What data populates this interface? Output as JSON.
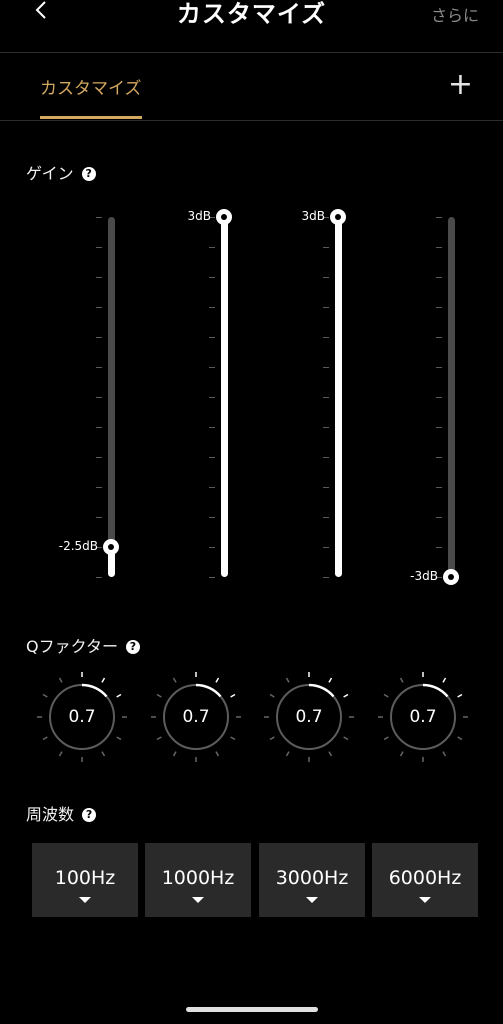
{
  "header": {
    "title": "カスタマイズ",
    "more_label": "さらに",
    "back_icon": "chevron-left-icon"
  },
  "tabs": {
    "active_label": "カスタマイズ",
    "add_icon": "plus-icon",
    "add_glyph": "+"
  },
  "colors": {
    "accent": "#d3a861",
    "track": "#4a4a4a",
    "fill": "#ffffff",
    "button_bg": "#2a2a2a"
  },
  "gain": {
    "label": "ゲイン",
    "help_glyph": "?",
    "range_db": [
      -3,
      3
    ],
    "bands": [
      {
        "value_label": "-2.5dB",
        "value_db": -2.5
      },
      {
        "value_label": "3dB",
        "value_db": 3
      },
      {
        "value_label": "3dB",
        "value_db": 3
      },
      {
        "value_label": "-3dB",
        "value_db": -3
      }
    ]
  },
  "q_factor": {
    "label": "Qファクター",
    "help_glyph": "?",
    "knobs": [
      {
        "value": "0.7"
      },
      {
        "value": "0.7"
      },
      {
        "value": "0.7"
      },
      {
        "value": "0.7"
      }
    ]
  },
  "frequency": {
    "label": "周波数",
    "help_glyph": "?",
    "options": [
      {
        "label": "100Hz"
      },
      {
        "label": "1000Hz"
      },
      {
        "label": "3000Hz"
      },
      {
        "label": "6000Hz"
      }
    ]
  }
}
